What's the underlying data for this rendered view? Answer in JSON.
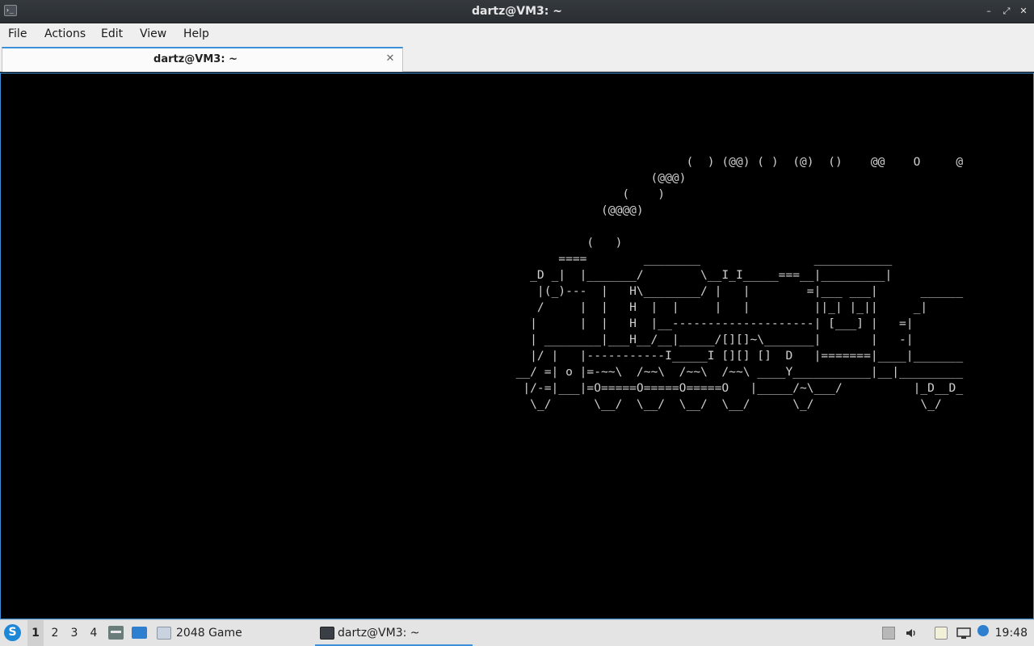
{
  "window": {
    "title": "dartz@VM3: ~",
    "app_icon_glyph": "›_",
    "minimize_glyph": "–",
    "maximize_glyph": "⤢",
    "close_glyph": "✕"
  },
  "menubar": {
    "items": [
      "File",
      "Actions",
      "Edit",
      "View",
      "Help"
    ]
  },
  "tabs": [
    {
      "label": "dartz@VM3: ~",
      "close_glyph": "✕"
    }
  ],
  "terminal": {
    "ascii_art": "                          (  ) (@@) ( )  (@)  ()    @@    O     @\n                     (@@@)\n                 (    )\n              (@@@@)\n\n            (   )\n        ====        ________                ___________\n    _D _|  |_______/        \\__I_I_____===__|_________|\n     |(_)---  |   H\\________/ |   |        =|___ ___|      ______\n     /     |  |   H  |  |     |   |         ||_| |_||     _|\n    |      |  |   H  |__--------------------| [___] |   =|\n    | ________|___H__/__|_____/[][]~\\_______|       |   -|\n    |/ |   |-----------I_____I [][] []  D   |=======|____|_______\n  __/ =| o |=-~~\\  /~~\\  /~~\\  /~~\\ ____Y___________|__|_________\n   |/-=|___|=O=====O=====O=====O   |_____/~\\___/          |_D__D_\n    \\_/      \\__/  \\__/  \\__/  \\__/      \\_/               \\_/"
  },
  "taskbar": {
    "start_glyph": "S",
    "desktops": [
      "1",
      "2",
      "3",
      "4"
    ],
    "active_desktop": "1",
    "tasks": [
      {
        "label": "2048 Game",
        "icon": "window-icon"
      },
      {
        "label": "dartz@VM3: ~",
        "icon": "terminal-icon",
        "active": true
      }
    ],
    "tray_icons": [
      "eject-icon",
      "volume-icon",
      "clipboard-icon",
      "network-icon",
      "update-notifier-icon"
    ],
    "clock": "19:48"
  },
  "colors": {
    "accent": "#3c8fd8",
    "terminal_bg": "#000000",
    "terminal_fg": "#d0d0d0",
    "titlebar_bg": "#2f3338"
  }
}
